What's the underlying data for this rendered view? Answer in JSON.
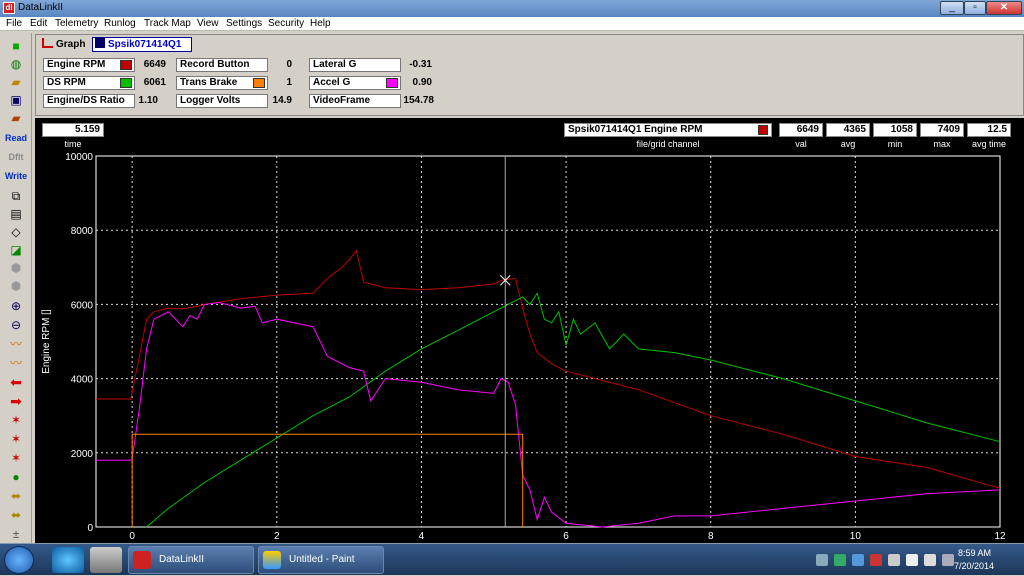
{
  "window": {
    "title": "DataLinkII",
    "app_icon": "dl",
    "min": "_",
    "max": "▫",
    "close": "✕"
  },
  "menu": [
    "File",
    "Edit",
    "Telemetry",
    "Runlog",
    "Track Map",
    "View",
    "Settings",
    "Security",
    "Help"
  ],
  "toolbar": {
    "read": "Read",
    "dflt": "Dflt",
    "write": "Write"
  },
  "tabs": {
    "graph": "Graph",
    "file": "Spsik071414Q1"
  },
  "channels": [
    {
      "label": "Engine RPM",
      "color": "#c00000",
      "value": "6649"
    },
    {
      "label": "Record Button",
      "color": "",
      "value": "0"
    },
    {
      "label": "Lateral G",
      "color": "",
      "value": "-0.31"
    },
    {
      "label": "DS RPM",
      "color": "#00c000",
      "value": "6061"
    },
    {
      "label": "Trans Brake",
      "color": "#ff8000",
      "value": "1"
    },
    {
      "label": "Accel G",
      "color": "#ff00ff",
      "value": "0.90"
    },
    {
      "label": "Engine/DS Ratio",
      "color": "",
      "value": "1.10"
    },
    {
      "label": "Logger Volts",
      "color": "",
      "value": "14.9"
    },
    {
      "label": "VideoFrame",
      "color": "",
      "value": "154.78"
    }
  ],
  "readout": {
    "time": "5.159",
    "time_label": "time",
    "file_channel": "Spsik071414Q1    Engine RPM",
    "file_channel_label": "file/grid channel",
    "val": "6649",
    "avg": "4365",
    "min": "1058",
    "max": "7409",
    "avg_time": "12.5",
    "val_label": "val",
    "avg_label": "avg",
    "min_label": "min",
    "max_label": "max",
    "avg_time_label": "avg time"
  },
  "taskbar": {
    "app1": "DataLinkII",
    "app2": "Untitled - Paint",
    "time": "8:59 AM",
    "date": "7/20/2014"
  },
  "chart_data": {
    "type": "line",
    "ylabel": "Engine RPM []",
    "xlim": [
      -0.5,
      12
    ],
    "ylim": [
      0,
      10000
    ],
    "xticks": [
      "0",
      "2",
      "4",
      "6",
      "8",
      "10",
      "12"
    ],
    "yticks": [
      "0",
      "2000",
      "4000",
      "6000",
      "8000",
      "10000"
    ],
    "grid": true,
    "cursor_x": 5.159,
    "series": [
      {
        "color": "#c00000",
        "x": [
          -0.5,
          -0.02,
          0,
          0.1,
          0.2,
          0.3,
          0.5,
          0.7,
          0.9,
          1.0,
          1.5,
          2,
          2.5,
          2.7,
          2.9,
          3.0,
          3.1,
          3.2,
          3.5,
          4,
          4.5,
          5.0,
          5.1,
          5.3,
          5.4,
          5.5,
          5.6,
          5.8,
          6,
          7,
          8,
          9,
          10,
          11,
          11.8,
          12
        ],
        "y": [
          3450,
          3450,
          3650,
          4600,
          5600,
          5800,
          5900,
          5880,
          5950,
          6000,
          6150,
          6250,
          6300,
          6700,
          7000,
          7200,
          7450,
          6600,
          6450,
          6400,
          6450,
          6550,
          6650,
          6700,
          5900,
          5200,
          4700,
          4400,
          4200,
          3700,
          3000,
          2500,
          1900,
          1600,
          1150,
          1050
        ]
      },
      {
        "color": "#00c000",
        "x": [
          0.2,
          0.5,
          1,
          1.5,
          2,
          2.5,
          3,
          3.5,
          4,
          4.5,
          5,
          5.2,
          5.4,
          5.5,
          5.6,
          5.7,
          5.8,
          5.9,
          6,
          6.1,
          6.2,
          6.4,
          6.6,
          6.8,
          7,
          7.5,
          8,
          9,
          10,
          11,
          12
        ],
        "y": [
          0,
          500,
          1200,
          1800,
          2400,
          3000,
          3500,
          4200,
          4800,
          5300,
          5800,
          6000,
          6200,
          6000,
          6300,
          5600,
          5500,
          5800,
          4900,
          5600,
          5200,
          5500,
          4800,
          5200,
          4800,
          4700,
          4500,
          4000,
          3400,
          2800,
          2300
        ]
      },
      {
        "color": "#ff00ff",
        "x": [
          -0.5,
          -0.02,
          0,
          0.1,
          0.2,
          0.3,
          0.5,
          0.7,
          0.8,
          0.9,
          1.0,
          1.2,
          1.5,
          1.7,
          1.8,
          2.0,
          2.5,
          2.7,
          3.0,
          3.2,
          3.3,
          3.5,
          4,
          4.5,
          5,
          5.1,
          5.2,
          5.3,
          5.4,
          5.5,
          5.6,
          5.7,
          5.8,
          6,
          6.5,
          7,
          7.5,
          8,
          9,
          10,
          11,
          12
        ],
        "y": [
          1800,
          1800,
          1850,
          3200,
          4800,
          5600,
          5800,
          5400,
          5700,
          5600,
          6000,
          6050,
          5900,
          5950,
          5500,
          5600,
          5400,
          4600,
          4300,
          4200,
          3400,
          4000,
          3900,
          3700,
          3600,
          4000,
          3900,
          3300,
          1400,
          1000,
          200,
          800,
          400,
          100,
          0,
          100,
          300,
          300,
          500,
          700,
          900,
          1000
        ]
      },
      {
        "color": "#ff8000",
        "x": [
          0,
          0,
          0.05,
          5.4,
          5.4
        ],
        "y": [
          0,
          2500,
          2500,
          2500,
          0
        ]
      }
    ]
  }
}
